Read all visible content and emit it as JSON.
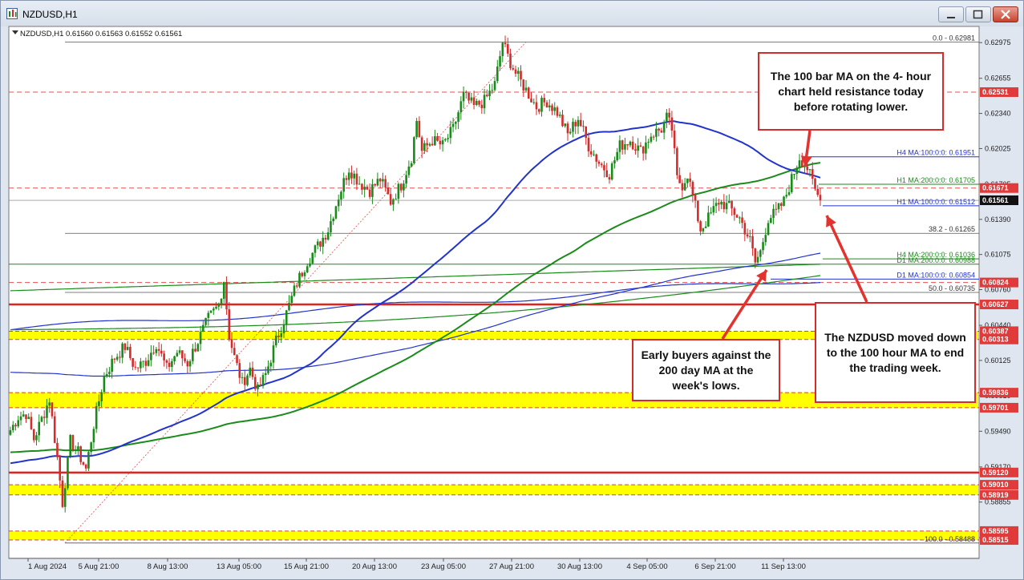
{
  "window": {
    "title": "NZDUSD,H1",
    "buttons": [
      "minimize-button",
      "restore-button",
      "close-button"
    ]
  },
  "chart_data": {
    "type": "candlestick",
    "symbol_header": "NZDUSD,H1  0.61560 0.61563 0.61552 0.61561",
    "ylim": [
      0.5835,
      0.6312
    ],
    "price_ticks": [
      "0.62975",
      "0.62655",
      "0.62340",
      "0.62025",
      "0.61705",
      "0.61390",
      "0.61075",
      "0.60760",
      "0.60440",
      "0.60125",
      "0.59810",
      "0.59490",
      "0.59170",
      "0.58855",
      "0.58535"
    ],
    "time_ticks": [
      "1 Aug 2024",
      "5 Aug 21:00",
      "8 Aug 13:00",
      "13 Aug 05:00",
      "15 Aug 21:00",
      "20 Aug 13:00",
      "23 Aug 05:00",
      "27 Aug 21:00",
      "30 Aug 13:00",
      "4 Sep 05:00",
      "6 Sep 21:00",
      "11 Sep 13:00"
    ],
    "price_labels": [
      {
        "text": "0.62531",
        "price": 0.62531,
        "color": "#e03a3a"
      },
      {
        "text": "0.61671",
        "price": 0.61671,
        "color": "#e03a3a"
      },
      {
        "text": "0.61561",
        "price": 0.61561,
        "color": "#111111"
      },
      {
        "text": "0.60824",
        "price": 0.60824,
        "color": "#e03a3a"
      },
      {
        "text": "0.60627",
        "price": 0.60627,
        "color": "#e03a3a"
      },
      {
        "text": "0.60387",
        "price": 0.60387,
        "color": "#e03a3a"
      },
      {
        "text": "0.60313",
        "price": 0.60313,
        "color": "#e03a3a"
      },
      {
        "text": "0.59836",
        "price": 0.59836,
        "color": "#e03a3a"
      },
      {
        "text": "0.59701",
        "price": 0.59701,
        "color": "#e03a3a"
      },
      {
        "text": "0.59120",
        "price": 0.5912,
        "color": "#e03a3a"
      },
      {
        "text": "0.59010",
        "price": 0.5901,
        "color": "#e03a3a"
      },
      {
        "text": "0.58919",
        "price": 0.58919,
        "color": "#e03a3a"
      },
      {
        "text": "0.58595",
        "price": 0.58595,
        "color": "#e03a3a"
      },
      {
        "text": "0.58515",
        "price": 0.58515,
        "color": "#e03a3a"
      }
    ],
    "fib_labels": [
      {
        "text": "0.0 - 0.62981",
        "price": 0.62981
      },
      {
        "text": "38.2 - 0.61265",
        "price": 0.61265
      },
      {
        "text": "50.0 - 0.60735",
        "price": 0.60735
      },
      {
        "text": "100.0 - 0.58488",
        "price": 0.58488
      }
    ],
    "ma_labels": [
      {
        "text": "H4 MA:100:0:0: 0.61951",
        "price": 0.61951,
        "color": "#2233cc"
      },
      {
        "text": "H1 MA:200:0:0: 0.61705",
        "price": 0.61705,
        "color": "#1a8a1a"
      },
      {
        "text": "H1 MA:100:0:0: 0.61512",
        "price": 0.61512,
        "color": "#2233cc"
      },
      {
        "text": "H4 MA:200:0:0: 0.61036",
        "price": 0.61036,
        "color": "#1a8a1a"
      },
      {
        "text": "D1 MA:200:0:0: 0.60988",
        "price": 0.60988,
        "color": "#1a8a1a"
      },
      {
        "text": "D1 MA:100:0:0: 0.60854",
        "price": 0.60854,
        "color": "#2233cc"
      }
    ],
    "yellow_zones": [
      [
        0.60313,
        0.60387
      ],
      [
        0.59701,
        0.59836
      ],
      [
        0.58919,
        0.5901
      ],
      [
        0.58515,
        0.58595
      ]
    ],
    "red_lines": [
      0.60627,
      0.5912
    ],
    "dashed_red_lines": [
      0.62531,
      0.61671,
      0.60824
    ],
    "close_price": 0.61561,
    "path_key_points": [
      [
        0,
        0.595
      ],
      [
        3,
        0.5962
      ],
      [
        6,
        0.5965
      ],
      [
        9,
        0.5942
      ],
      [
        12,
        0.596
      ],
      [
        15,
        0.5978
      ],
      [
        18,
        0.5925
      ],
      [
        20,
        0.5885
      ],
      [
        23,
        0.594
      ],
      [
        26,
        0.593
      ],
      [
        29,
        0.5915
      ],
      [
        32,
        0.5955
      ],
      [
        36,
        0.5998
      ],
      [
        40,
        0.6015
      ],
      [
        44,
        0.6025
      ],
      [
        48,
        0.6005
      ],
      [
        52,
        0.6012
      ],
      [
        56,
        0.6028
      ],
      [
        60,
        0.6005
      ],
      [
        64,
        0.602
      ],
      [
        68,
        0.601
      ],
      [
        72,
        0.603
      ],
      [
        76,
        0.605
      ],
      [
        80,
        0.6062
      ],
      [
        82,
        0.6085
      ],
      [
        84,
        0.6035
      ],
      [
        86,
        0.6015
      ],
      [
        89,
        0.5992
      ],
      [
        92,
        0.6005
      ],
      [
        95,
        0.5985
      ],
      [
        98,
        0.6
      ],
      [
        102,
        0.603
      ],
      [
        106,
        0.6055
      ],
      [
        110,
        0.6082
      ],
      [
        114,
        0.6102
      ],
      [
        118,
        0.6115
      ],
      [
        122,
        0.613
      ],
      [
        126,
        0.616
      ],
      [
        130,
        0.6185
      ],
      [
        134,
        0.6172
      ],
      [
        138,
        0.6165
      ],
      [
        142,
        0.6175
      ],
      [
        146,
        0.6155
      ],
      [
        150,
        0.617
      ],
      [
        154,
        0.6195
      ],
      [
        156,
        0.6228
      ],
      [
        158,
        0.62
      ],
      [
        162,
        0.621
      ],
      [
        166,
        0.6205
      ],
      [
        170,
        0.622
      ],
      [
        174,
        0.625
      ],
      [
        178,
        0.624
      ],
      [
        182,
        0.6245
      ],
      [
        186,
        0.626
      ],
      [
        189,
        0.6298
      ],
      [
        191,
        0.6285
      ],
      [
        194,
        0.627
      ],
      [
        198,
        0.6255
      ],
      [
        202,
        0.624
      ],
      [
        206,
        0.6245
      ],
      [
        210,
        0.6235
      ],
      [
        214,
        0.6215
      ],
      [
        218,
        0.623
      ],
      [
        222,
        0.6205
      ],
      [
        226,
        0.619
      ],
      [
        230,
        0.618
      ],
      [
        234,
        0.6205
      ],
      [
        238,
        0.621
      ],
      [
        242,
        0.62
      ],
      [
        246,
        0.6215
      ],
      [
        250,
        0.622
      ],
      [
        252,
        0.623
      ],
      [
        254,
        0.622
      ],
      [
        256,
        0.6175
      ],
      [
        258,
        0.617
      ],
      [
        260,
        0.618
      ],
      [
        262,
        0.616
      ],
      [
        265,
        0.613
      ],
      [
        268,
        0.614
      ],
      [
        272,
        0.6155
      ],
      [
        276,
        0.615
      ],
      [
        280,
        0.614
      ],
      [
        284,
        0.612
      ],
      [
        286,
        0.61
      ],
      [
        288,
        0.611
      ],
      [
        291,
        0.614
      ],
      [
        294,
        0.6145
      ],
      [
        297,
        0.6155
      ],
      [
        300,
        0.6175
      ],
      [
        303,
        0.6195
      ],
      [
        306,
        0.6185
      ],
      [
        309,
        0.6165
      ],
      [
        311,
        0.6156
      ]
    ],
    "annotations": [
      {
        "text": "The 100 bar MA on the 4- hour chart held resistance today before rotating lower."
      },
      {
        "text": "Early buyers against the 200 day MA at the week's lows."
      },
      {
        "text": "The NZDUSD moved down to the 100 hour MA to end the trading week."
      }
    ]
  }
}
